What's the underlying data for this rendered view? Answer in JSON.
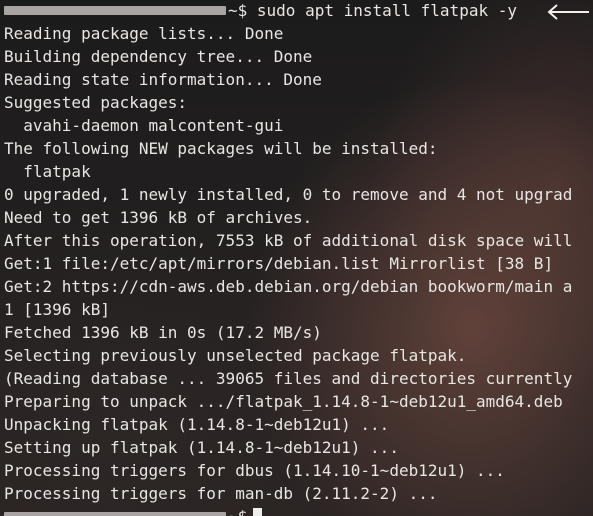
{
  "terminal": {
    "command_prompt_suffix": "~$ sudo apt install flatpak -y",
    "output_lines": [
      "Reading package lists... Done",
      "Building dependency tree... Done",
      "Reading state information... Done",
      "Suggested packages:",
      "  avahi-daemon malcontent-gui",
      "The following NEW packages will be installed:",
      "  flatpak",
      "0 upgraded, 1 newly installed, 0 to remove and 4 not upgrad",
      "Need to get 1396 kB of archives.",
      "After this operation, 7553 kB of additional disk space will",
      "Get:1 file:/etc/apt/mirrors/debian.list Mirrorlist [38 B]",
      "Get:2 https://cdn-aws.deb.debian.org/debian bookworm/main a",
      "1 [1396 kB]",
      "Fetched 1396 kB in 0s (17.2 MB/s)",
      "Selecting previously unselected package flatpak.",
      "(Reading database ... 39065 files and directories currently",
      "Preparing to unpack .../flatpak_1.14.8-1~deb12u1_amd64.deb",
      "Unpacking flatpak (1.14.8-1~deb12u1) ...",
      "Setting up flatpak (1.14.8-1~deb12u1) ...",
      "Processing triggers for dbus (1.14.10-1~deb12u1) ...",
      "Processing triggers for man-db (2.11.2-2) ..."
    ],
    "final_prompt_suffix": "~$"
  }
}
